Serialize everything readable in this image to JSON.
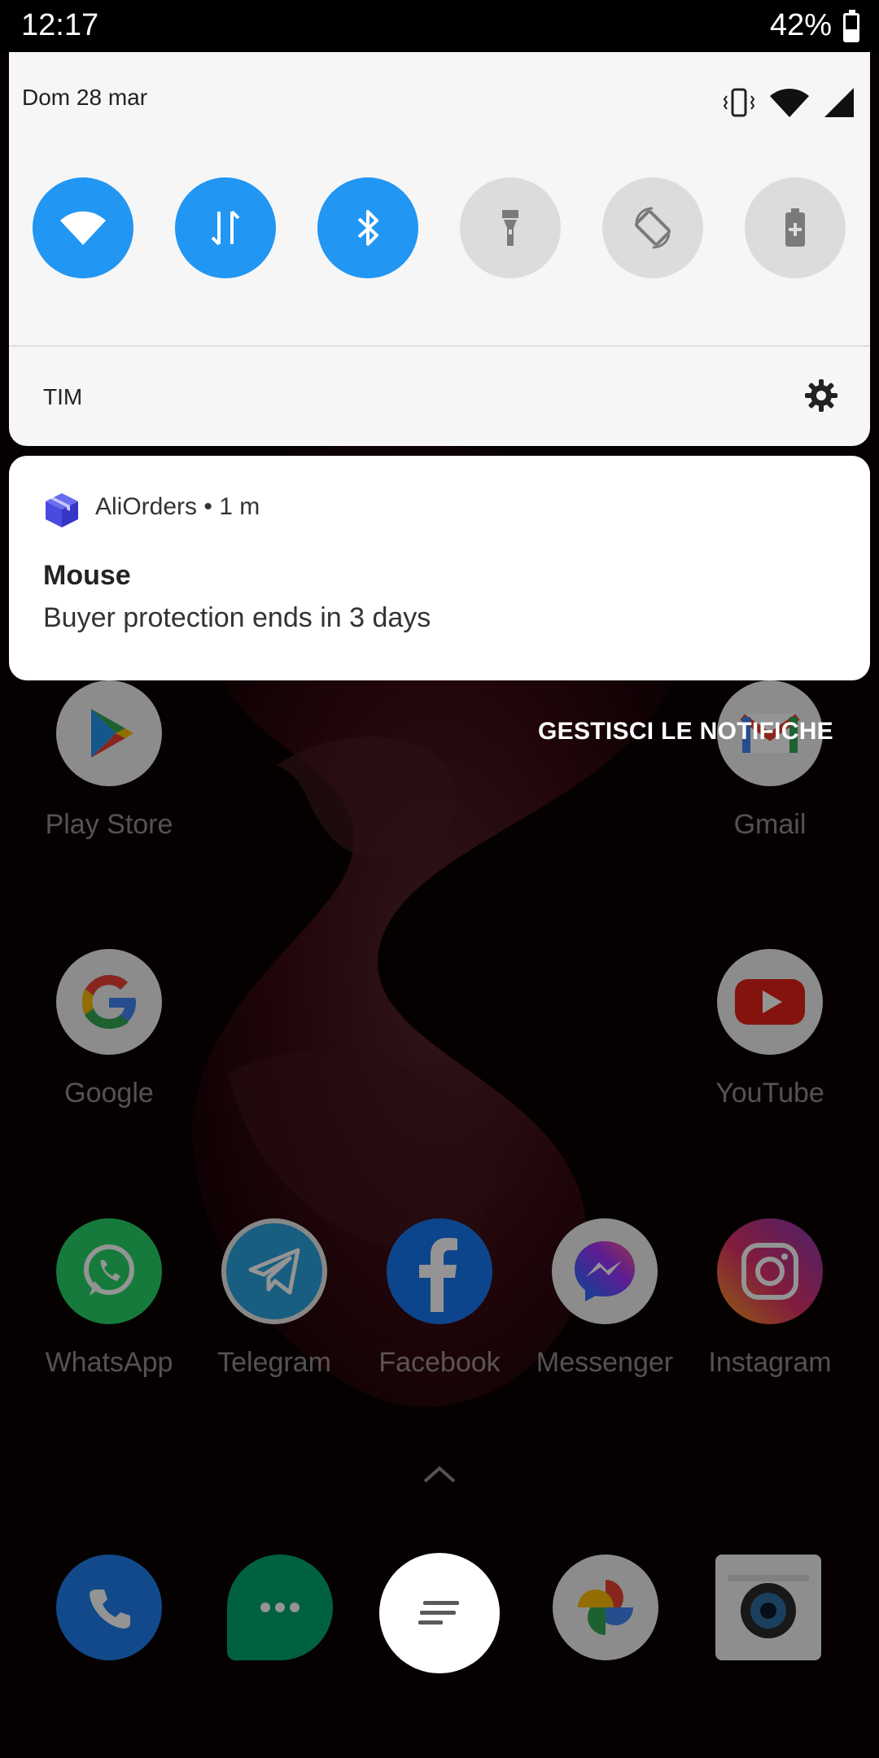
{
  "status_bar": {
    "time": "12:17",
    "battery": "42%",
    "battery_level": 0.42
  },
  "quick_settings": {
    "date": "Dom 28 mar",
    "carrier": "TIM",
    "tiles": [
      {
        "name": "wifi",
        "state": "on"
      },
      {
        "name": "mobile-data",
        "state": "on"
      },
      {
        "name": "bluetooth",
        "state": "on"
      },
      {
        "name": "flashlight",
        "state": "off"
      },
      {
        "name": "auto-rotate",
        "state": "off"
      },
      {
        "name": "battery-saver",
        "state": "off"
      }
    ],
    "accent_color": "#2196f3"
  },
  "notification": {
    "app_name": "AliOrders",
    "time": "1 m",
    "header_separator": " • ",
    "title": "Mouse",
    "body": "Buyer protection ends in 3 days"
  },
  "manage_notifications_label": "GESTISCI LE NOTIFICHE",
  "home_apps": {
    "row1": [
      {
        "label": "Play Store",
        "icon": "play-store-icon"
      },
      {
        "label": "Gmail",
        "icon": "gmail-icon"
      }
    ],
    "row2": [
      {
        "label": "Google",
        "icon": "google-icon"
      },
      {
        "label": "YouTube",
        "icon": "youtube-icon"
      }
    ],
    "row3": [
      {
        "label": "WhatsApp",
        "icon": "whatsapp-icon"
      },
      {
        "label": "Telegram",
        "icon": "telegram-icon"
      },
      {
        "label": "Facebook",
        "icon": "facebook-icon"
      },
      {
        "label": "Messenger",
        "icon": "messenger-icon"
      },
      {
        "label": "Instagram",
        "icon": "instagram-icon"
      }
    ]
  },
  "dock": [
    {
      "icon": "phone-icon"
    },
    {
      "icon": "messages-icon"
    },
    {
      "icon": "app-drawer-icon"
    },
    {
      "icon": "photos-icon"
    },
    {
      "icon": "camera-icon"
    }
  ]
}
